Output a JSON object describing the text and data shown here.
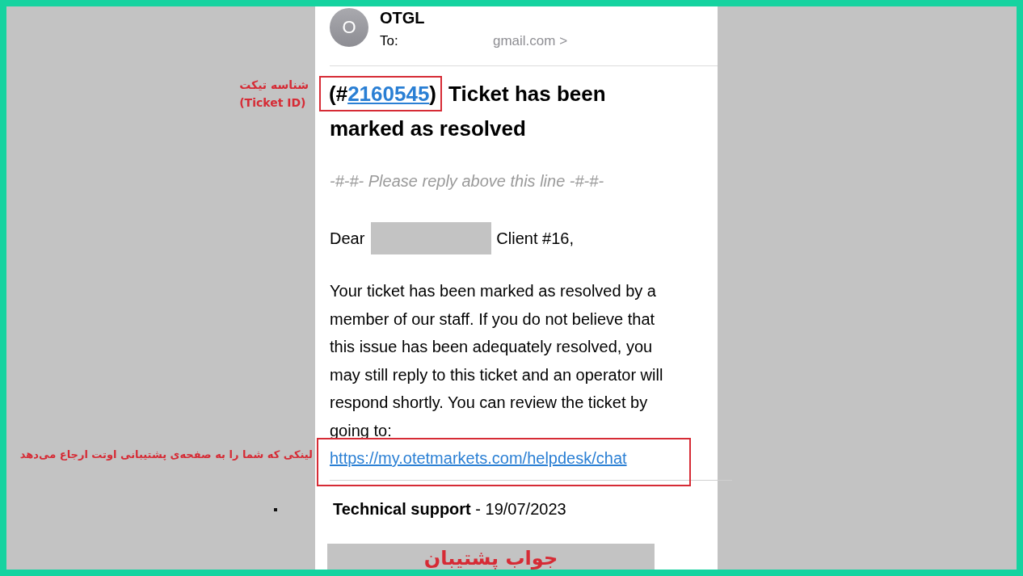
{
  "sender": {
    "initial": "O",
    "name": "OTGL",
    "to_label": "To:",
    "to_address": "gmail.com >"
  },
  "subject": {
    "prefix": "(#",
    "ticket_number": "2160545",
    "suffix": ")",
    "title_lines": [
      "Ticket has been",
      "marked as resolved"
    ]
  },
  "reply_marker": "-#-#- Please reply above this line -#-#-",
  "greeting": {
    "salutation": "Dear",
    "client": "Client #16,"
  },
  "body": "Your ticket has been marked as resolved by a member of our staff. If you do not believe that this issue has been adequately resolved, you may still reply to this ticket and an operator will respond shortly. You can review the ticket by going to:",
  "review_link": "https://my.otetmarkets.com/helpdesk/chat",
  "signature": "**Technical support** - 19/07/2023",
  "annotations": {
    "ticket_id": [
      "شناسه تیکت",
      "(Ticket ID)"
    ],
    "link_note": "لینکی که شما را به صفحه‌ی پشتیبانی اوتت ارجاع می‌دهد",
    "reply_banner": "جواب پشتیبان"
  }
}
